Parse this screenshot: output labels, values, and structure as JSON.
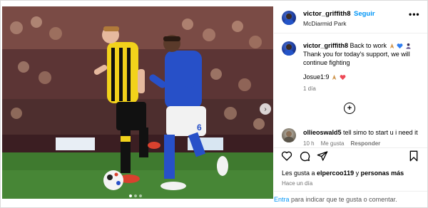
{
  "post": {
    "username": "victor_griffith8",
    "separator": "•",
    "follow_label": "Seguir",
    "location": "McDiarmid Park",
    "more_icon": "more-dots-icon",
    "caption_line1": "Back to work",
    "caption_line2": "Thank you for today's support, we will continue fighting",
    "caption_tag": "Josue1:9",
    "caption_time": "1 día",
    "carousel": {
      "total_slides": 3,
      "active_slide": 1
    }
  },
  "comment": {
    "username": "ollieoswald5",
    "text": "tell simo to start u i need it",
    "time": "10 h",
    "likes": "Me gusta",
    "reply": "Responder"
  },
  "likes": {
    "prefix": "Les gusta a ",
    "user": "elpercoo119",
    "middle": " y ",
    "others": "personas más"
  },
  "post_time": "Hace un día",
  "comment_bar": {
    "enter_label": "Entra",
    "rest": " para indicar que te gusta o comentar."
  },
  "colors": {
    "accent": "#0095f6",
    "meta": "#737373",
    "heart": "#ed4956",
    "blue_heart": "#2f7ef2"
  },
  "icons": {
    "like": "heart-icon",
    "comment": "comment-icon",
    "share": "send-icon",
    "save": "bookmark-icon",
    "add": "plus-circle-icon",
    "next": "chevron-right-icon"
  }
}
